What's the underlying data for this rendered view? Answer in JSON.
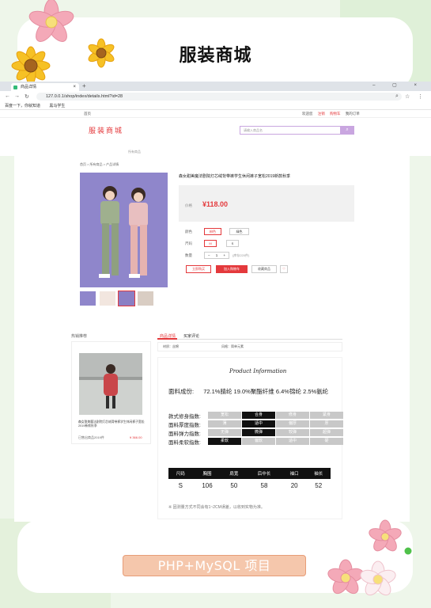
{
  "header": {
    "title": "服装商城"
  },
  "browser": {
    "tab_title": "商品详情",
    "tab_close": "×",
    "new_tab": "+",
    "window_controls": "–  ▢  ×",
    "url": "127.0.0.1/shop/index/details.html?id=28",
    "bookmarks": [
      "百度一下，你就知道",
      "黑马学生"
    ]
  },
  "site": {
    "home_link": "首页",
    "top_links": [
      "欢迎您",
      "注销",
      "购物车",
      "我的订单"
    ],
    "logo": "服装商城",
    "search_placeholder": "请输入商品名",
    "search_button": "⌕",
    "subnav": "所有商品"
  },
  "product": {
    "breadcrumb": "首页 > 所有商品 > 产品详情",
    "title": "森女甜美魔法剧院灯芯绒背带裤学生休闲裤子宽松2019新款秋季",
    "price_label": "价格",
    "price": "¥118.00",
    "color_label": "颜色",
    "colors": [
      "粉色",
      "绿色"
    ],
    "size_label": "尺码",
    "sizes": [
      "M",
      "S"
    ],
    "qty_label": "数量",
    "qty_value": "1",
    "qty_minus": "−",
    "qty_plus": "+",
    "stock": "(库存220件)",
    "buy_button": "立即购买",
    "cart_button": "加入购物车",
    "fav_button": "收藏商品",
    "share_button": "♡"
  },
  "hot": {
    "label": "热销推荐",
    "name": "森女甜美魔法剧院灯芯绒背带裤学生休闲裤子宽松2019新款秋季",
    "sold": "已售出商品2019件",
    "price": "¥ 366.00"
  },
  "detail": {
    "tabs": [
      "商品详情",
      "买家评论"
    ],
    "attrs": [
      "材质：丝棉",
      "风格：简单元素"
    ],
    "info_title": "Product Information",
    "fabric_label": "面料成份:",
    "fabric_value": "72.1%腈纶 19.0%聚酯纤维 6.4%锦纶 2.5%氨纶",
    "indices": [
      {
        "label": "款式修身指数:",
        "cells": [
          "宽松",
          "合身",
          "修身",
          "紧身"
        ],
        "on": 1
      },
      {
        "label": "面料厚度指数:",
        "cells": [
          "薄",
          "适中",
          "偏厚",
          "厚"
        ],
        "on": 1
      },
      {
        "label": "面料弹力指数:",
        "cells": [
          "无弹",
          "微弹",
          "较弹",
          "超弹"
        ],
        "on": 1
      },
      {
        "label": "面料柔软指数:",
        "cells": [
          "柔软",
          "偏软",
          "适中",
          "硬"
        ],
        "on": 0
      }
    ],
    "size_table": {
      "headers": [
        "尺码",
        "胸围",
        "肩宽",
        "后中长",
        "袖口",
        "袖长"
      ],
      "rows": [
        [
          "S",
          "106",
          "50",
          "58",
          "20",
          "52"
        ]
      ]
    },
    "note": "※ 因测量方式不同会有1~2CM误差，以收到实物为准。"
  },
  "footer": {
    "label": "PHP+MySQL 项目"
  },
  "colors": {
    "accent": "#e4393c",
    "purple": "#c9a6e0",
    "bg": "#eef6ea"
  }
}
